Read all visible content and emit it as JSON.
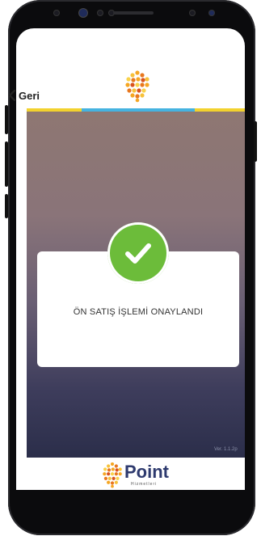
{
  "header": {
    "back_label": "Geri"
  },
  "stripes": {
    "colors": [
      "#f2d22e",
      "#45b3e0",
      "#f2d22e"
    ]
  },
  "dialog": {
    "message": "ÖN SATIŞ İŞLEMİ ONAYLANDI",
    "icon": "checkmark-icon",
    "icon_color": "#6cbc3a"
  },
  "footer": {
    "brand": "Point",
    "brand_sub": "Hizmetleri",
    "version": "Ver. 1.1.2p"
  },
  "colors": {
    "brand_text": "#2e3a6e",
    "success": "#6cbc3a"
  }
}
